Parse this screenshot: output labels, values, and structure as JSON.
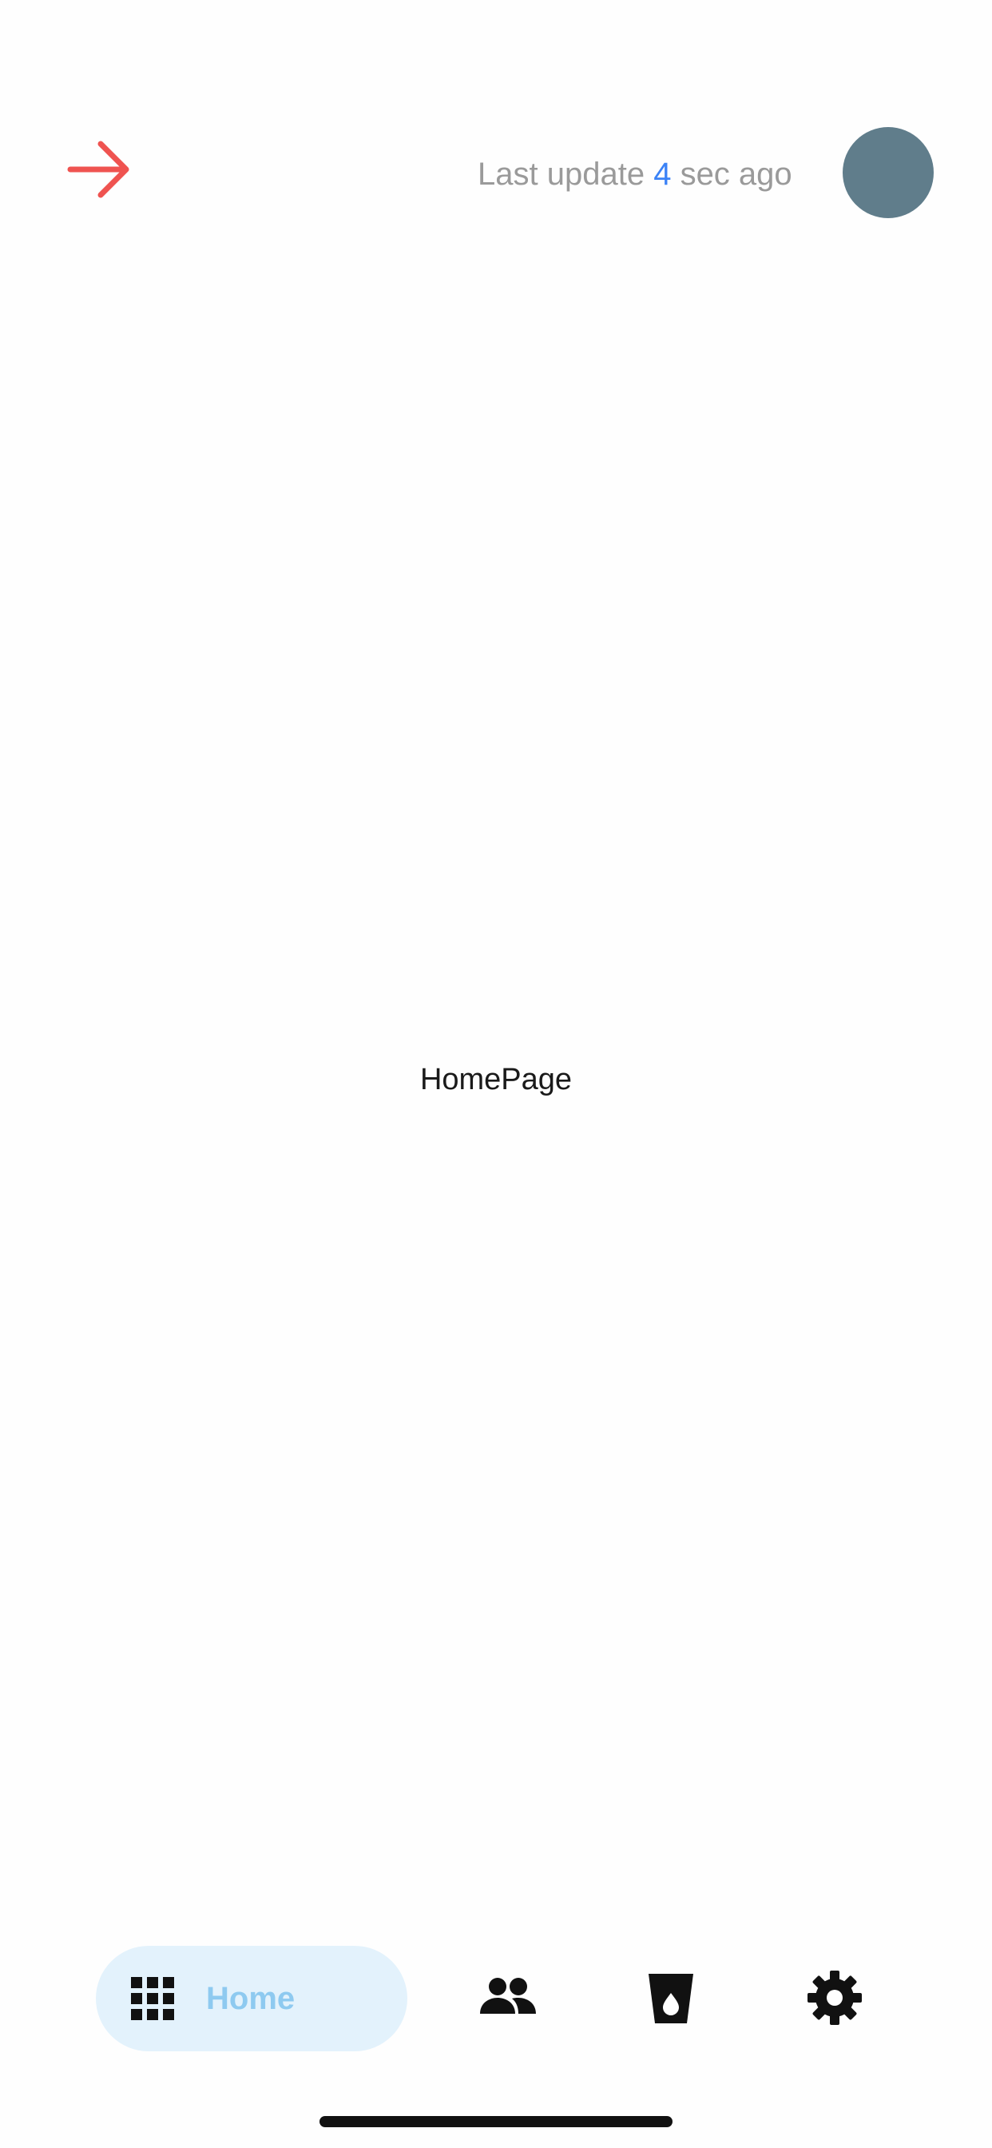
{
  "header": {
    "last_update_prefix": "Last update",
    "last_update_count": "4",
    "last_update_suffix": "sec ago",
    "back_icon": "arrow-right-icon",
    "avatar_color": "#607d8b"
  },
  "main": {
    "title": "HomePage"
  },
  "bottom_nav": {
    "items": [
      {
        "label": "Home",
        "icon": "grid-icon",
        "active": true
      },
      {
        "label": "",
        "icon": "people-icon",
        "active": false
      },
      {
        "label": "",
        "icon": "cup-drop-icon",
        "active": false
      },
      {
        "label": "",
        "icon": "gear-icon",
        "active": false
      }
    ],
    "active_bg": "#e3f2fc",
    "active_text": "#8ecaf0"
  },
  "colors": {
    "accent_red": "#ef5350",
    "count_blue": "#3b82f6"
  }
}
